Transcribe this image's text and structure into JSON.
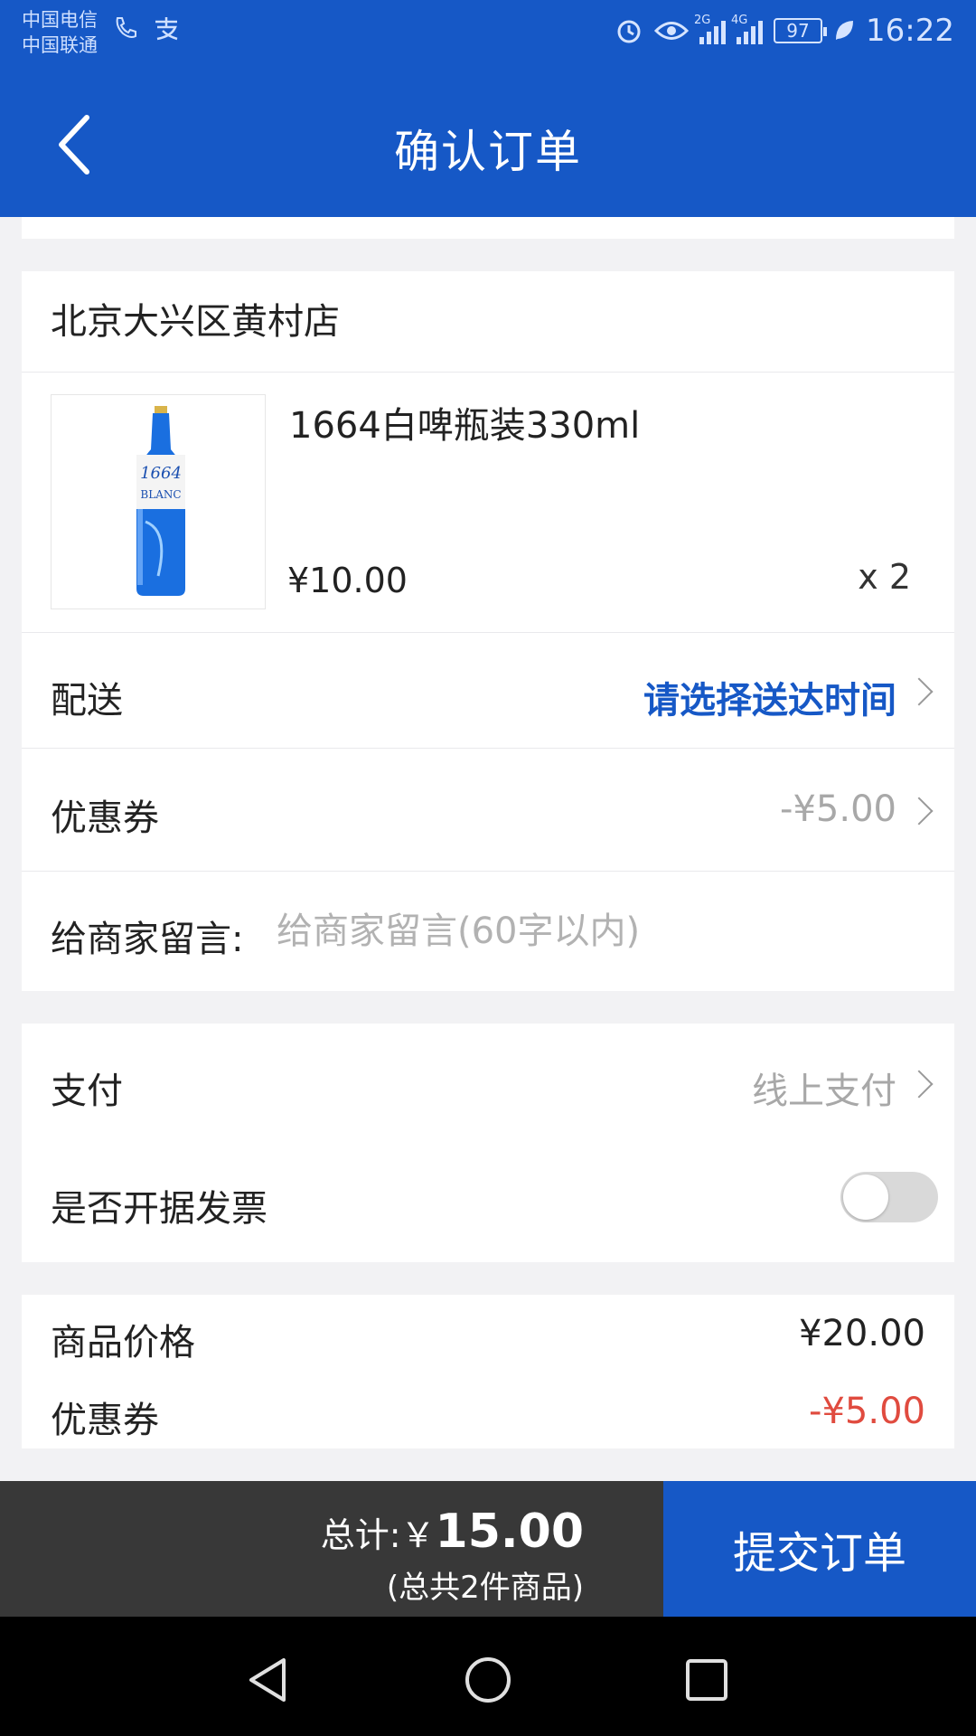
{
  "status_bar": {
    "carrier_1": "中国电信",
    "carrier_2": "中国联通",
    "net_1": "2G",
    "net_2": "4G",
    "battery": "97",
    "time": "16:22"
  },
  "header": {
    "title": "确认订单"
  },
  "store": {
    "name": "北京大兴区黄村店"
  },
  "product": {
    "name": "1664白啤瓶装330ml",
    "price": "¥10.00",
    "quantity": "x 2"
  },
  "delivery": {
    "label": "配送",
    "value": "请选择送达时间"
  },
  "coupon": {
    "label": "优惠券",
    "value": "-¥5.00"
  },
  "message": {
    "label": "给商家留言:",
    "placeholder": "给商家留言(60字以内)",
    "value": ""
  },
  "payment": {
    "label": "支付",
    "value": "线上支付"
  },
  "invoice": {
    "label": "是否开据发票",
    "enabled": false
  },
  "summary": {
    "goods_label": "商品价格",
    "goods_value": "¥20.00",
    "coupon_label": "优惠券",
    "coupon_value": "-¥5.00"
  },
  "footer": {
    "total_prefix": "总计:￥",
    "total_amount": "15.00",
    "item_count": "(总共2件商品)",
    "submit_label": "提交订单"
  },
  "colors": {
    "brand": "#1658c6",
    "discount": "#e04b3f",
    "muted": "#a8a8a8"
  }
}
